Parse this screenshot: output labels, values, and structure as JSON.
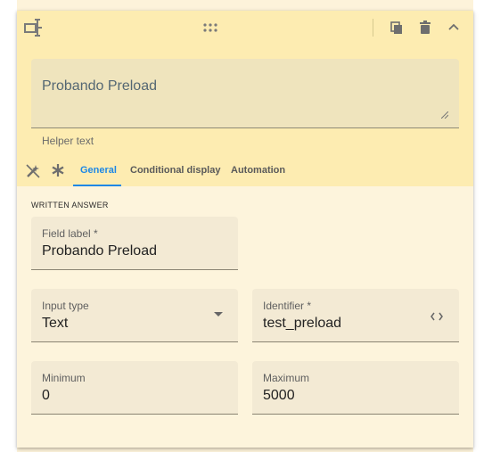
{
  "toolbar": {
    "field_type_icon": "text-field-icon",
    "drag_icon": "drag-handle-icon",
    "duplicate_icon": "copy-icon",
    "delete_icon": "trash-icon",
    "collapse_icon": "chevron-up-icon"
  },
  "question": {
    "text": "Probando Preload",
    "helper_text": "Helper text"
  },
  "tabs": [
    {
      "label": "General",
      "active": true
    },
    {
      "label": "Conditional display",
      "active": false
    },
    {
      "label": "Automation",
      "active": false
    }
  ],
  "tab_icons": [
    "magic-wand-off-icon",
    "asterisk-icon"
  ],
  "section": {
    "title": "WRITTEN ANSWER"
  },
  "fields": {
    "field_label": {
      "label": "Field label *",
      "value": "Probando Preload"
    },
    "input_type": {
      "label": "Input type",
      "value": "Text"
    },
    "identifier": {
      "label": "Identifier *",
      "value": "test_preload"
    },
    "minimum": {
      "label": "Minimum",
      "value": "0"
    },
    "maximum": {
      "label": "Maximum",
      "value": "5000"
    }
  },
  "colors": {
    "header_bg": "#fdecb1",
    "card_bg": "#fdf4dc",
    "accent": "#1e88e5"
  }
}
